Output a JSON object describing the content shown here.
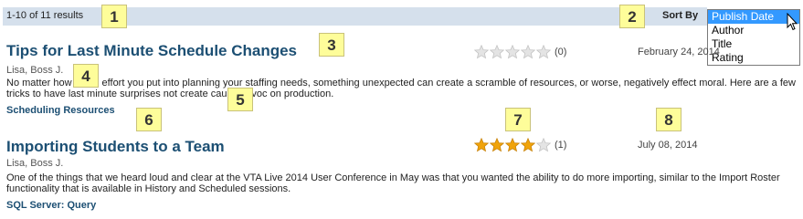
{
  "header": {
    "results_count": "1-10 of 11 results",
    "sort_label": "Sort By"
  },
  "sort_dropdown": {
    "options": [
      "Publish Date",
      "Author",
      "Title",
      "Rating"
    ],
    "selected": "Publish Date"
  },
  "callouts": [
    "1",
    "2",
    "3",
    "4",
    "5",
    "6",
    "7",
    "8"
  ],
  "articles": [
    {
      "title": "Tips for Last Minute Schedule Changes",
      "author": "Lisa, Boss J.",
      "summary": "No matter how much effort you put into planning your staffing needs, something unexpected can create a scramble of resources, or worse, negatively effect moral. Here are a few tricks to have last minute surprises not create cause havoc on production.",
      "category": "Scheduling Resources",
      "rating_stars": 0,
      "rating_max": 5,
      "rating_count": "(0)",
      "date": "February 24, 2014"
    },
    {
      "title": "Importing Students to a Team",
      "author": "Lisa, Boss J.",
      "summary": "One of the things that we heard loud and clear at the VTA Live 2014 User Conference in May was that you wanted the ability to do more importing, similar to the Import Roster functionality that is available in History and Scheduled sessions.",
      "category": "SQL Server: Query",
      "rating_stars": 4,
      "rating_max": 5,
      "rating_count": "(1)",
      "date": "July 08, 2014"
    }
  ],
  "colors": {
    "header_bar": "#d5e0ec",
    "title": "#1c4f73",
    "star_filled": "#f0a30a",
    "star_empty": "#e4e4e4",
    "selected_option": "#3399ff",
    "callout": "#fefd9a"
  }
}
